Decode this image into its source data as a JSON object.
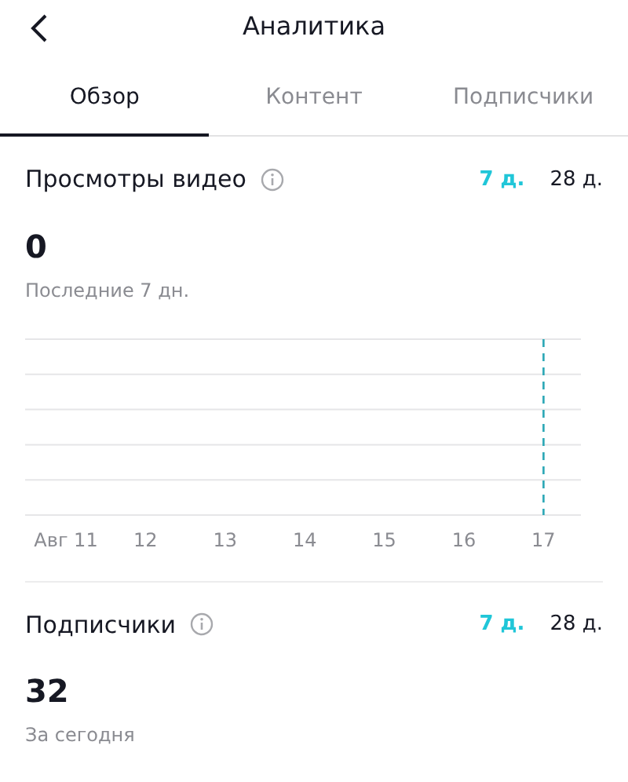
{
  "header": {
    "title": "Аналитика"
  },
  "tabs": [
    {
      "label": "Обзор",
      "selected": true
    },
    {
      "label": "Контент",
      "selected": false
    },
    {
      "label": "Подписчики",
      "selected": false
    }
  ],
  "sections": [
    {
      "title": "Просмотры видео",
      "periods": [
        {
          "label": "7 д.",
          "selected": true
        },
        {
          "label": "28 д.",
          "selected": false
        }
      ],
      "value": "0",
      "caption": "Последние 7 дн.",
      "x_labels": [
        "Авг 11",
        "12",
        "13",
        "14",
        "15",
        "16",
        "17"
      ]
    },
    {
      "title": "Подписчики",
      "periods": [
        {
          "label": "7 д.",
          "selected": true
        },
        {
          "label": "28 д.",
          "selected": false
        }
      ],
      "value": "32",
      "caption": "За сегодня"
    }
  ]
}
